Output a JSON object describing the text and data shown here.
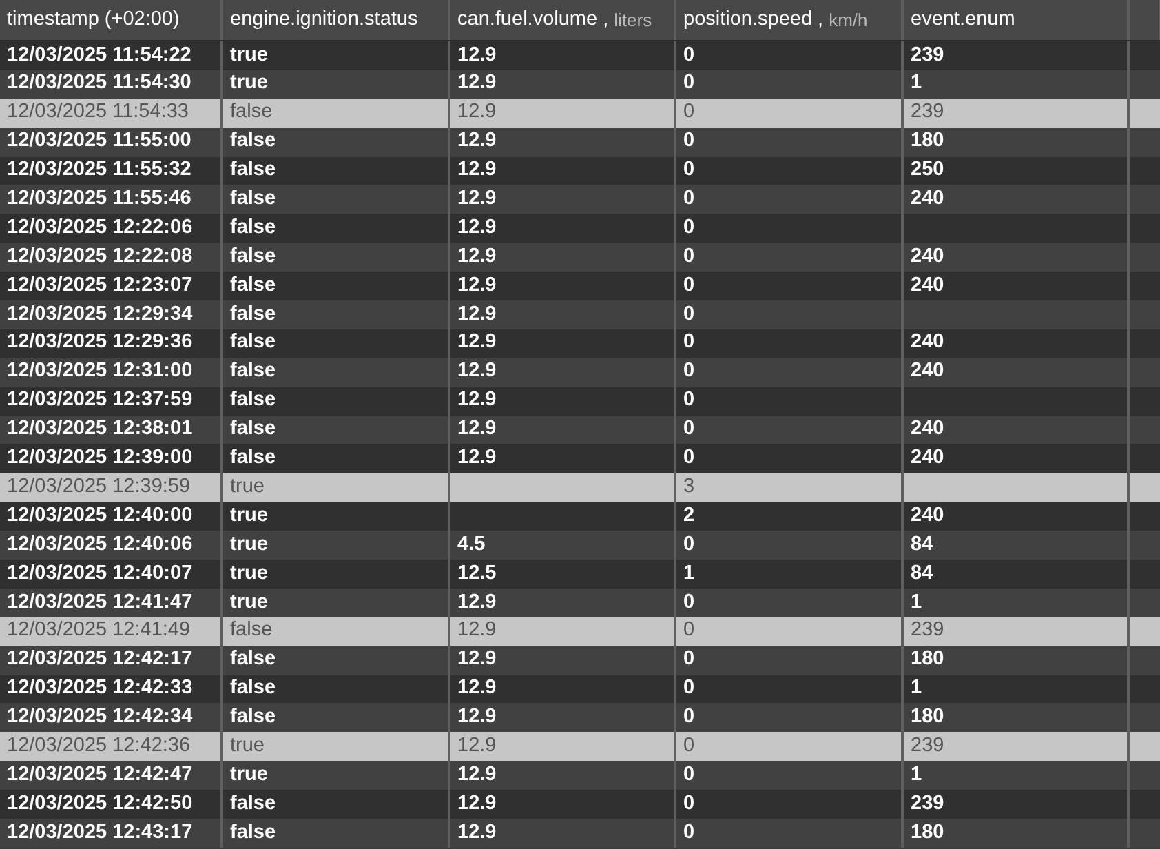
{
  "table": {
    "columns": [
      {
        "label": "timestamp (+02:00)"
      },
      {
        "label": "engine.ignition.status"
      },
      {
        "label": "can.fuel.volume ,",
        "unit": "liters"
      },
      {
        "label": "position.speed ,",
        "unit": "km/h"
      },
      {
        "label": "event.enum"
      }
    ],
    "rows": [
      {
        "selected": false,
        "cells": [
          "12/03/2025 11:54:22",
          "true",
          "12.9",
          "0",
          "239"
        ]
      },
      {
        "selected": false,
        "cells": [
          "12/03/2025 11:54:30",
          "true",
          "12.9",
          "0",
          "1"
        ]
      },
      {
        "selected": true,
        "cells": [
          "12/03/2025 11:54:33",
          "false",
          "12.9",
          "0",
          "239"
        ]
      },
      {
        "selected": false,
        "cells": [
          "12/03/2025 11:55:00",
          "false",
          "12.9",
          "0",
          "180"
        ]
      },
      {
        "selected": false,
        "cells": [
          "12/03/2025 11:55:32",
          "false",
          "12.9",
          "0",
          "250"
        ]
      },
      {
        "selected": false,
        "cells": [
          "12/03/2025 11:55:46",
          "false",
          "12.9",
          "0",
          "240"
        ]
      },
      {
        "selected": false,
        "cells": [
          "12/03/2025 12:22:06",
          "false",
          "12.9",
          "0",
          ""
        ]
      },
      {
        "selected": false,
        "cells": [
          "12/03/2025 12:22:08",
          "false",
          "12.9",
          "0",
          "240"
        ]
      },
      {
        "selected": false,
        "cells": [
          "12/03/2025 12:23:07",
          "false",
          "12.9",
          "0",
          "240"
        ]
      },
      {
        "selected": false,
        "cells": [
          "12/03/2025 12:29:34",
          "false",
          "12.9",
          "0",
          ""
        ]
      },
      {
        "selected": false,
        "cells": [
          "12/03/2025 12:29:36",
          "false",
          "12.9",
          "0",
          "240"
        ]
      },
      {
        "selected": false,
        "cells": [
          "12/03/2025 12:31:00",
          "false",
          "12.9",
          "0",
          "240"
        ]
      },
      {
        "selected": false,
        "cells": [
          "12/03/2025 12:37:59",
          "false",
          "12.9",
          "0",
          ""
        ]
      },
      {
        "selected": false,
        "cells": [
          "12/03/2025 12:38:01",
          "false",
          "12.9",
          "0",
          "240"
        ]
      },
      {
        "selected": false,
        "cells": [
          "12/03/2025 12:39:00",
          "false",
          "12.9",
          "0",
          "240"
        ]
      },
      {
        "selected": true,
        "cells": [
          "12/03/2025 12:39:59",
          "true",
          "",
          "3",
          ""
        ]
      },
      {
        "selected": false,
        "cells": [
          "12/03/2025 12:40:00",
          "true",
          "",
          "2",
          "240"
        ]
      },
      {
        "selected": false,
        "cells": [
          "12/03/2025 12:40:06",
          "true",
          "4.5",
          "0",
          "84"
        ]
      },
      {
        "selected": false,
        "cells": [
          "12/03/2025 12:40:07",
          "true",
          "12.5",
          "1",
          "84"
        ]
      },
      {
        "selected": false,
        "cells": [
          "12/03/2025 12:41:47",
          "true",
          "12.9",
          "0",
          "1"
        ]
      },
      {
        "selected": true,
        "cells": [
          "12/03/2025 12:41:49",
          "false",
          "12.9",
          "0",
          "239"
        ]
      },
      {
        "selected": false,
        "cells": [
          "12/03/2025 12:42:17",
          "false",
          "12.9",
          "0",
          "180"
        ]
      },
      {
        "selected": false,
        "cells": [
          "12/03/2025 12:42:33",
          "false",
          "12.9",
          "0",
          "1"
        ]
      },
      {
        "selected": false,
        "cells": [
          "12/03/2025 12:42:34",
          "false",
          "12.9",
          "0",
          "180"
        ]
      },
      {
        "selected": true,
        "cells": [
          "12/03/2025 12:42:36",
          "true",
          "12.9",
          "0",
          "239"
        ]
      },
      {
        "selected": false,
        "cells": [
          "12/03/2025 12:42:47",
          "true",
          "12.9",
          "0",
          "1"
        ]
      },
      {
        "selected": false,
        "cells": [
          "12/03/2025 12:42:50",
          "false",
          "12.9",
          "0",
          "239"
        ]
      },
      {
        "selected": false,
        "cells": [
          "12/03/2025 12:43:17",
          "false",
          "12.9",
          "0",
          "180"
        ]
      }
    ]
  }
}
